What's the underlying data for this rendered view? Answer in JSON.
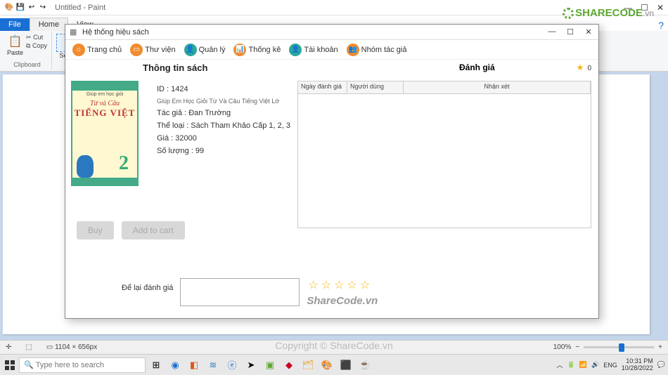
{
  "paint": {
    "title": "Untitled - Paint",
    "tabs": {
      "file": "File",
      "home": "Home",
      "view": "View"
    },
    "ribbon": {
      "paste": "Paste",
      "cut": "Cut",
      "copy": "Copy",
      "clipboard_label": "Clipboard",
      "select": "Select"
    },
    "status": {
      "canvas_size": "1104 × 656px",
      "zoom": "100%"
    }
  },
  "app": {
    "window_title": "Hệ thống hiệu sách",
    "nav": [
      "Trang chủ",
      "Thư viện",
      "Quản lý",
      "Thống kê",
      "Tài khoản",
      "Nhóm tác giả"
    ],
    "section_info": "Thông tin sách",
    "cover": {
      "line1": "Từ và Câu",
      "line2": "TIẾNG VIỆT",
      "grade": "2",
      "top_small": "Giúp em học giỏi"
    },
    "book": {
      "id_label": "ID : 1424",
      "subtitle": "Giúp Em Học Giỏi Từ Và Câu Tiếng Việt Lớ",
      "author": "Tác giả : Đan Trường",
      "category": "Thể loại : Sách Tham Khảo Cấp 1, 2, 3",
      "price": "Giá : 32000",
      "qty": "Số lượng : 99"
    },
    "buttons": {
      "buy": "Buy",
      "add": "Add to cart"
    },
    "rating": {
      "title": "Đánh giá",
      "count": "0"
    },
    "table": {
      "col1": "Ngày đánh giá",
      "col2": "Người dùng",
      "col3": "Nhận xét"
    },
    "review_label": "Để lại đánh giá",
    "watermark": "ShareCode.vn"
  },
  "taskbar": {
    "search_placeholder": "Type here to search",
    "time": "10:31 PM",
    "date": "10/28/2022"
  },
  "logo": {
    "text": "SHARECODE",
    "suffix": ".vn"
  },
  "copyright": "Copyright © ShareCode.vn"
}
